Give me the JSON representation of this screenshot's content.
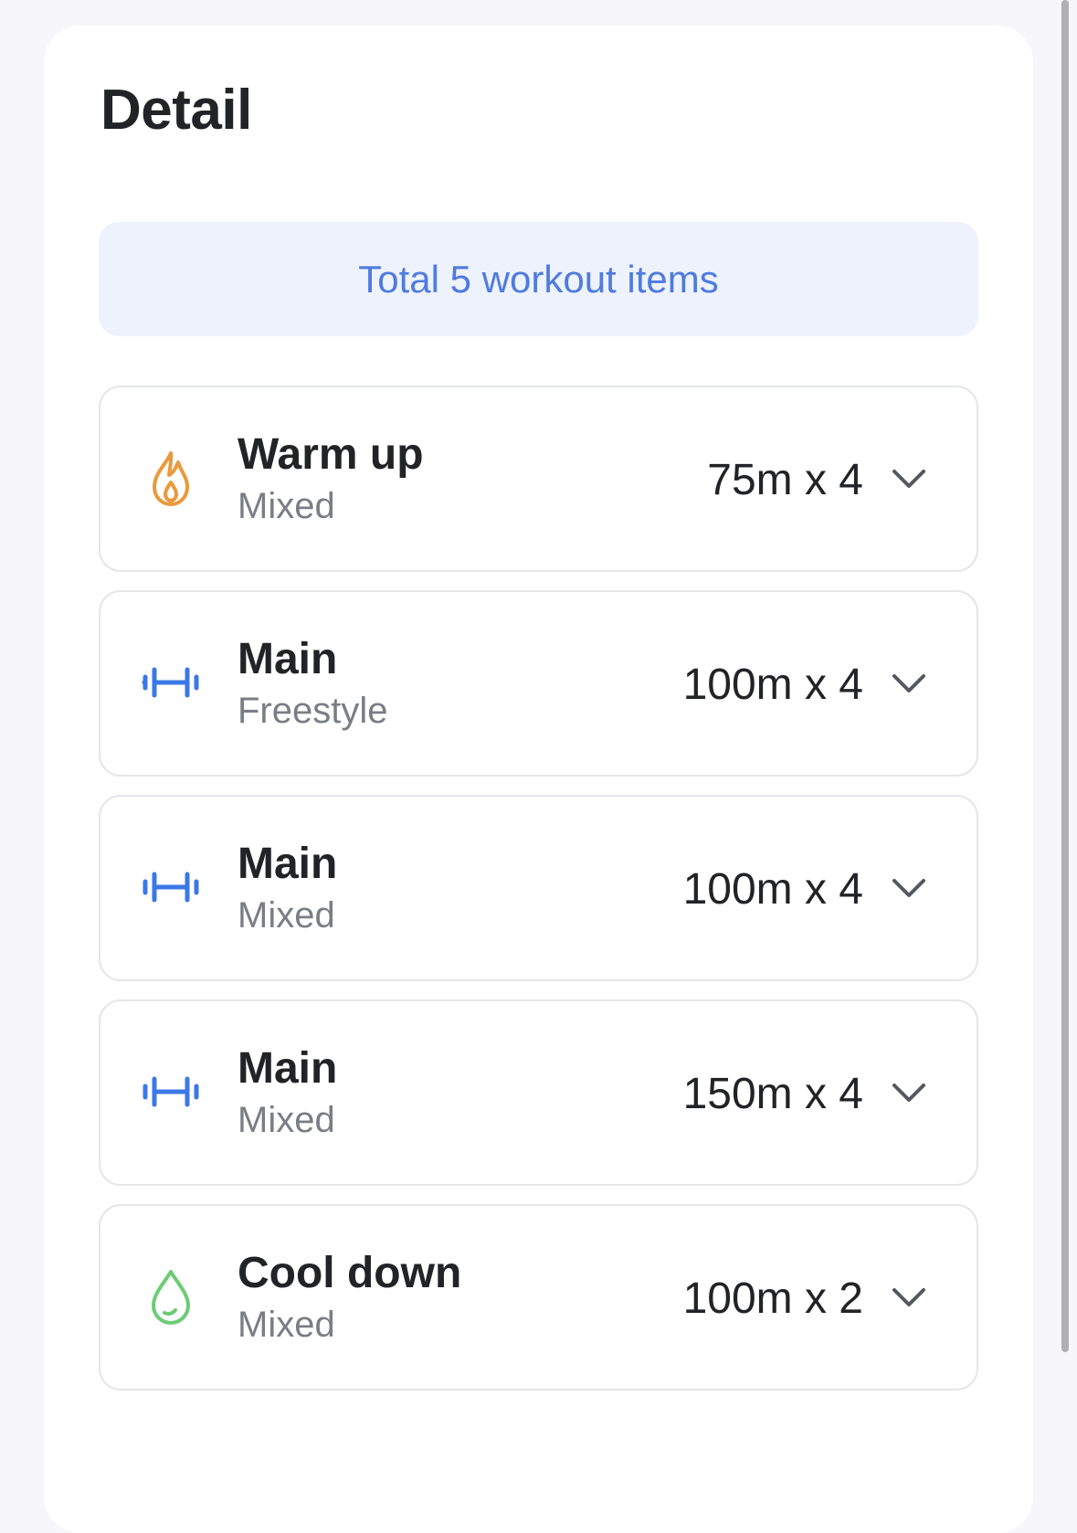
{
  "page": {
    "title": "Detail"
  },
  "summary": {
    "text": "Total 5 workout items"
  },
  "items": [
    {
      "title": "Warm up",
      "subtitle": "Mixed",
      "amount": "75m x 4",
      "icon": "flame-icon",
      "icon_color": "#e99a3b"
    },
    {
      "title": "Main",
      "subtitle": "Freestyle",
      "amount": "100m x 4",
      "icon": "dumbbell-icon",
      "icon_color": "#3b78e7"
    },
    {
      "title": "Main",
      "subtitle": "Mixed",
      "amount": "100m x 4",
      "icon": "dumbbell-icon",
      "icon_color": "#3b78e7"
    },
    {
      "title": "Main",
      "subtitle": "Mixed",
      "amount": "150m x 4",
      "icon": "dumbbell-icon",
      "icon_color": "#3b78e7"
    },
    {
      "title": "Cool down",
      "subtitle": "Mixed",
      "amount": "100m x 2",
      "icon": "droplet-icon",
      "icon_color": "#6ccc76"
    }
  ],
  "colors": {
    "accent": "#4f7be0",
    "summary_background": "#eef2fd",
    "page_background": "#f7f7f9"
  }
}
